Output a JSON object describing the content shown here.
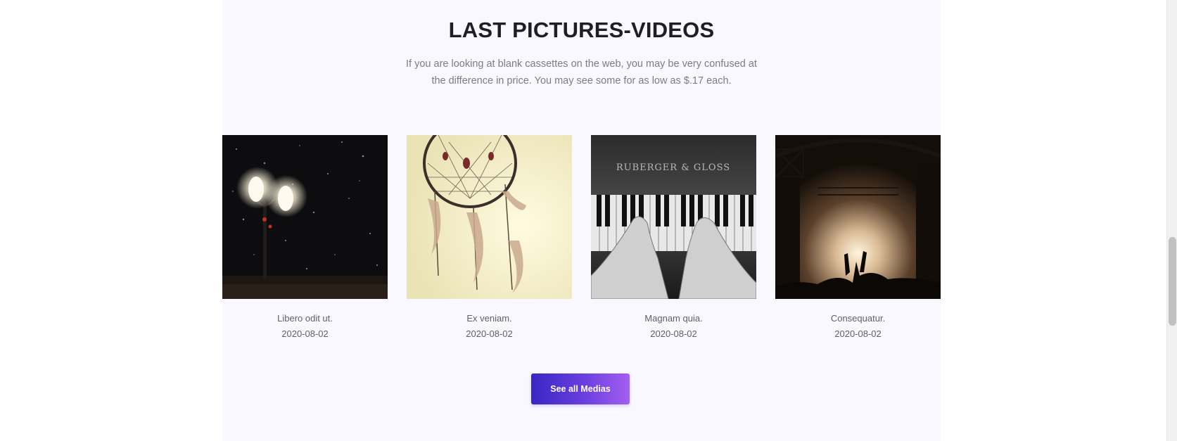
{
  "section": {
    "title": "LAST PICTURES-VIDEOS",
    "subtitle": "If you are looking at blank cassettes on the web, you may be very confused at the difference in price. You may see some for as low as $.17 each."
  },
  "media": [
    {
      "caption": "Libero odit ut.",
      "date": "2020-08-02",
      "image": "street-lamp-snow-night"
    },
    {
      "caption": "Ex veniam.",
      "date": "2020-08-02",
      "image": "dreamcatcher-feathers"
    },
    {
      "caption": "Magnam quia.",
      "date": "2020-08-02",
      "image": "hands-on-piano-keys",
      "image_text": "RUBERGER & GLOSS"
    },
    {
      "caption": "Consequatur.",
      "date": "2020-08-02",
      "image": "concert-stage-crowd"
    }
  ],
  "button": {
    "label": "See all Medias"
  },
  "colors": {
    "section_bg": "#f8f8fe",
    "title": "#1e1e23",
    "muted_text": "#7c7c85",
    "button_gradient_start": "#3a26c4",
    "button_gradient_end": "#a35ff0"
  }
}
